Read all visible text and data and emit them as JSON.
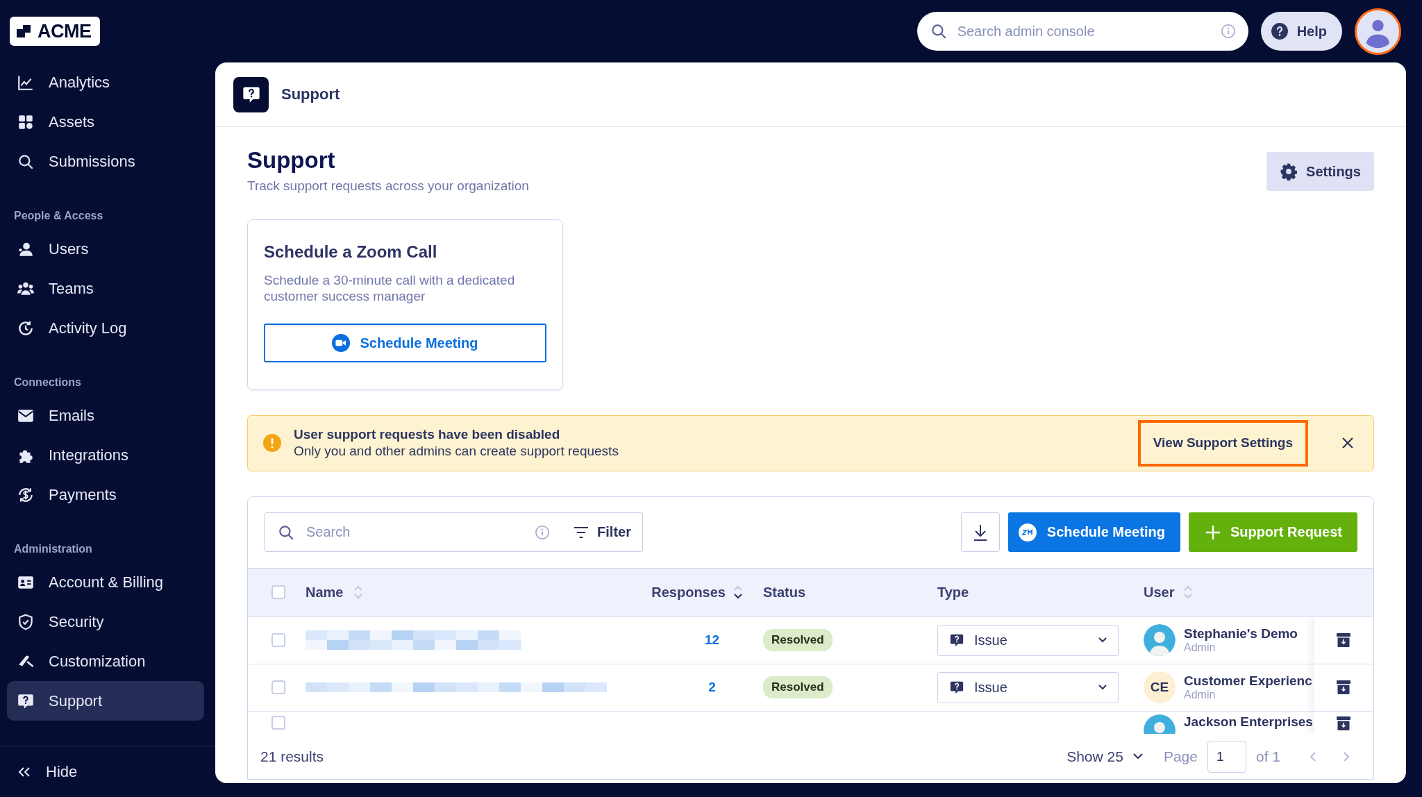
{
  "topbar": {
    "logo": "ACME",
    "search": {
      "placeholder": "Search admin console"
    },
    "help": "Help"
  },
  "sidebar": {
    "sections": [
      {
        "items": [
          {
            "label": "Analytics",
            "selected": false
          },
          {
            "label": "Assets",
            "selected": false
          },
          {
            "label": "Submissions",
            "selected": false
          }
        ]
      },
      {
        "heading": "People & Access",
        "items": [
          {
            "label": "Users",
            "selected": false
          },
          {
            "label": "Teams",
            "selected": false
          },
          {
            "label": "Activity Log",
            "selected": false
          }
        ]
      },
      {
        "heading": "Connections",
        "items": [
          {
            "label": "Emails",
            "selected": false
          },
          {
            "label": "Integrations",
            "selected": false
          },
          {
            "label": "Payments",
            "selected": false
          }
        ]
      },
      {
        "heading": "Administration",
        "items": [
          {
            "label": "Account & Billing",
            "selected": false
          },
          {
            "label": "Security",
            "selected": false
          },
          {
            "label": "Customization",
            "selected": false
          },
          {
            "label": "Support",
            "selected": true
          }
        ]
      }
    ],
    "hide": "Hide"
  },
  "page": {
    "breadcrumb": "Support",
    "title": "Support",
    "subtitle": "Track support requests across your organization",
    "settings": "Settings",
    "zoom_card": {
      "title": "Schedule a Zoom Call",
      "text": "Schedule a 30-minute call with a dedicated customer success manager",
      "button": "Schedule Meeting"
    },
    "banner": {
      "title": "User support requests have been disabled",
      "text": "Only you and other admins can create support requests",
      "action": "View Support Settings",
      "highlighted": true
    },
    "table": {
      "search": {
        "placeholder": "Search"
      },
      "filter": "Filter",
      "schedule": "Schedule Meeting",
      "new_request": "Support Request",
      "all_checked": false,
      "columns": [
        {
          "label": "Name",
          "sortable": true,
          "sorted": false
        },
        {
          "label": "Responses",
          "sortable": true,
          "sorted": true
        },
        {
          "label": "Status",
          "sortable": false
        },
        {
          "label": "Type",
          "sortable": false
        },
        {
          "label": "User",
          "sortable": true,
          "sorted": false
        }
      ],
      "rows": [
        {
          "checked": false,
          "name_redacted": true,
          "responses": "12",
          "status": "Resolved",
          "type": "Issue",
          "user": "Stephanie's Demo",
          "role": "Admin"
        },
        {
          "checked": false,
          "name_redacted": true,
          "responses": "2",
          "status": "Resolved",
          "type": "Issue",
          "user": "Customer Experienc",
          "role": "Admin",
          "initials": "CE"
        },
        {
          "checked": false,
          "user": "Jackson Enterprises"
        }
      ],
      "results": "21 results",
      "page_size": "Show 25",
      "page_label": "Page",
      "page": "1",
      "page_total": "of 1"
    }
  }
}
